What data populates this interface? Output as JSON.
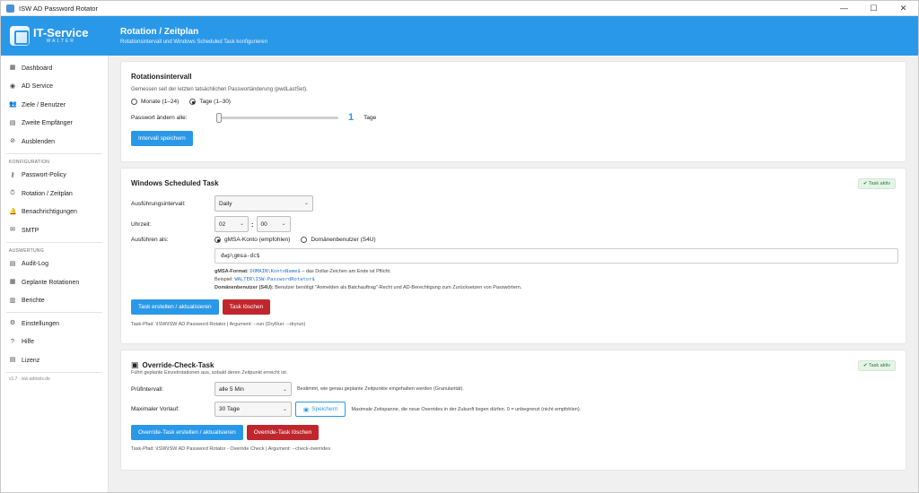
{
  "window": {
    "title": "ISW AD Password Rotator",
    "controls": [
      "—",
      "☐",
      "✕"
    ]
  },
  "logo": {
    "text": "IT-Service",
    "sub": "WALTER"
  },
  "header": {
    "title": "Rotation / Zeitplan",
    "subtitle": "Rotationsintervall und Windows Scheduled Task konfigurieren"
  },
  "sidebar": {
    "items1": [
      {
        "label": "Dashboard",
        "icon": "▦"
      },
      {
        "label": "AD Service",
        "icon": "◉"
      },
      {
        "label": "Ziele / Benutzer",
        "icon": "👥"
      },
      {
        "label": "Zweite Empfänger",
        "icon": "▤"
      },
      {
        "label": "Ausblenden",
        "icon": "⊘"
      }
    ],
    "sec_config": "KONFIGURATION",
    "items2": [
      {
        "label": "Passwort-Policy",
        "icon": "⚷"
      },
      {
        "label": "Rotation / Zeitplan",
        "icon": "⏱"
      },
      {
        "label": "Benachrichtigungen",
        "icon": "🔔"
      },
      {
        "label": "SMTP",
        "icon": "✉"
      }
    ],
    "sec_eval": "AUSWERTUNG",
    "items3": [
      {
        "label": "Audit-Log",
        "icon": "▤"
      },
      {
        "label": "Geplante Rotationen",
        "icon": "▦"
      },
      {
        "label": "Berichte",
        "icon": "▥"
      }
    ],
    "items4": [
      {
        "label": "Einstellungen",
        "icon": "⚙"
      },
      {
        "label": "Hilfe",
        "icon": "?"
      },
      {
        "label": "Lizenz",
        "icon": "▤"
      }
    ],
    "footer": "v1.7 · isw-adtools.de"
  },
  "rotation": {
    "title": "Rotationsintervall",
    "desc": "Gemessen seit der letzten tatsächlichen Passwortänderung (pwdLastSet).",
    "opt_months": "Monate (1–24)",
    "opt_days": "Tage (1–30)",
    "change_label": "Passwort ändern alle:",
    "value": "1",
    "unit": "Tage",
    "save": "Intervall speichern"
  },
  "task": {
    "title": "Windows Scheduled Task",
    "badge": "✔ Task aktiv",
    "interval_label": "Ausführungsintervall:",
    "interval_value": "Daily",
    "time_label": "Uhrzeit:",
    "hour": "02",
    "minute": "00",
    "runas_label": "Ausführen als:",
    "opt_gmsa": "gMSA-Konto (empfohlen)",
    "opt_domain": "Domänenbenutzer (S4U)",
    "account": "dwp\\gmsa-dc$",
    "fmt_label": "gMSA-Format:",
    "fmt_code": "DOMAIN\\KontoName$",
    "fmt_rest": " – das Dollar-Zeichen am Ende ist Pflicht.",
    "ex_label": "Beispiel: ",
    "ex_code": "WALTER\\ISW-PasswordRotator$",
    "domain_note_b": "Domänenbenutzer (S4U):",
    "domain_note": " Benutzer benötigt \"Anmelden als Batchauftrag\"-Recht und AD-Berechtigung zum Zurücksetzen von Passwörtern.",
    "create": "Task erstellen / aktualisieren",
    "delete": "Task löschen",
    "path": "Task-Pfad: \\ISW\\ISW AD Password Rotator  |  Argument: --run (DryRun: --dryrun)"
  },
  "override": {
    "title": "Override-Check-Task",
    "badge": "✔ Task aktiv",
    "desc": "Führt geplante Einzelrotationen aus, sobald deren Zeitpunkt erreicht ist.",
    "interval_label": "Prüfintervall:",
    "interval_value": "alle  5  Min",
    "interval_note": "Bestimmt, wie genau geplante Zeitpunkte eingehalten werden (Granularität).",
    "max_label": "Maximaler Vorlauf:",
    "max_value": "30 Tage",
    "save": "Speichern",
    "max_note": "Maximale Zeitspanne, die neue Overrides in der Zukunft liegen dürfen. 0 = unbegrenzt (nicht empfohlen).",
    "create": "Override-Task erstellen / aktualisieren",
    "delete": "Override-Task löschen",
    "path": "Task-Pfad: \\ISW\\ISW AD Password Rotator - Override Check  |  Argument: --check-overrides"
  },
  "colors": {
    "accent": "#2a98e8",
    "danger": "#c0272d",
    "success": "#2d7a3a"
  }
}
